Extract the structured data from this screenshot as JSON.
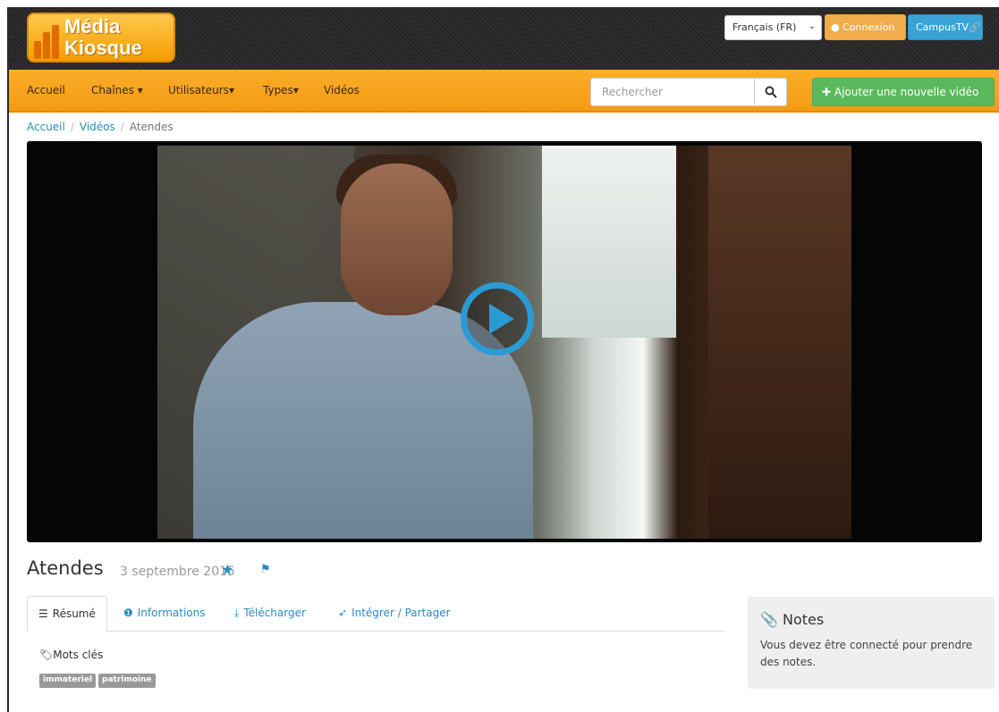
{
  "header": {
    "logo_line1": "Média",
    "logo_line2": "Kiosque",
    "language": "Français (FR)",
    "login_label": "Connexion",
    "campus_label": "CampusTV"
  },
  "nav": {
    "items": [
      "Accueil",
      "Chaînes",
      "Utilisateurs",
      "Types",
      "Vidéos"
    ],
    "search_placeholder": "Rechercher",
    "add_video_label": "Ajouter une nouvelle vidéo"
  },
  "breadcrumb": [
    "Accueil",
    "Vidéos",
    "Atendes"
  ],
  "video": {
    "title": "Atendes",
    "date": "3 septembre 2015"
  },
  "tabs": [
    {
      "label": "Résumé",
      "icon": "list-icon"
    },
    {
      "label": "Informations",
      "icon": "info-icon"
    },
    {
      "label": "Télécharger",
      "icon": "download-icon"
    },
    {
      "label": "Intégrer / Partager",
      "icon": "share-icon"
    }
  ],
  "keywords": {
    "title": "Mots clés",
    "tags": [
      "immateriel",
      "patrimoine"
    ]
  },
  "notes": {
    "title": "Notes",
    "text": "Vous devez être connecté pour prendre des notes."
  },
  "colors": {
    "accent": "#2a8cc0",
    "nav_orange": "#f7a11b",
    "green": "#5cb85c"
  }
}
